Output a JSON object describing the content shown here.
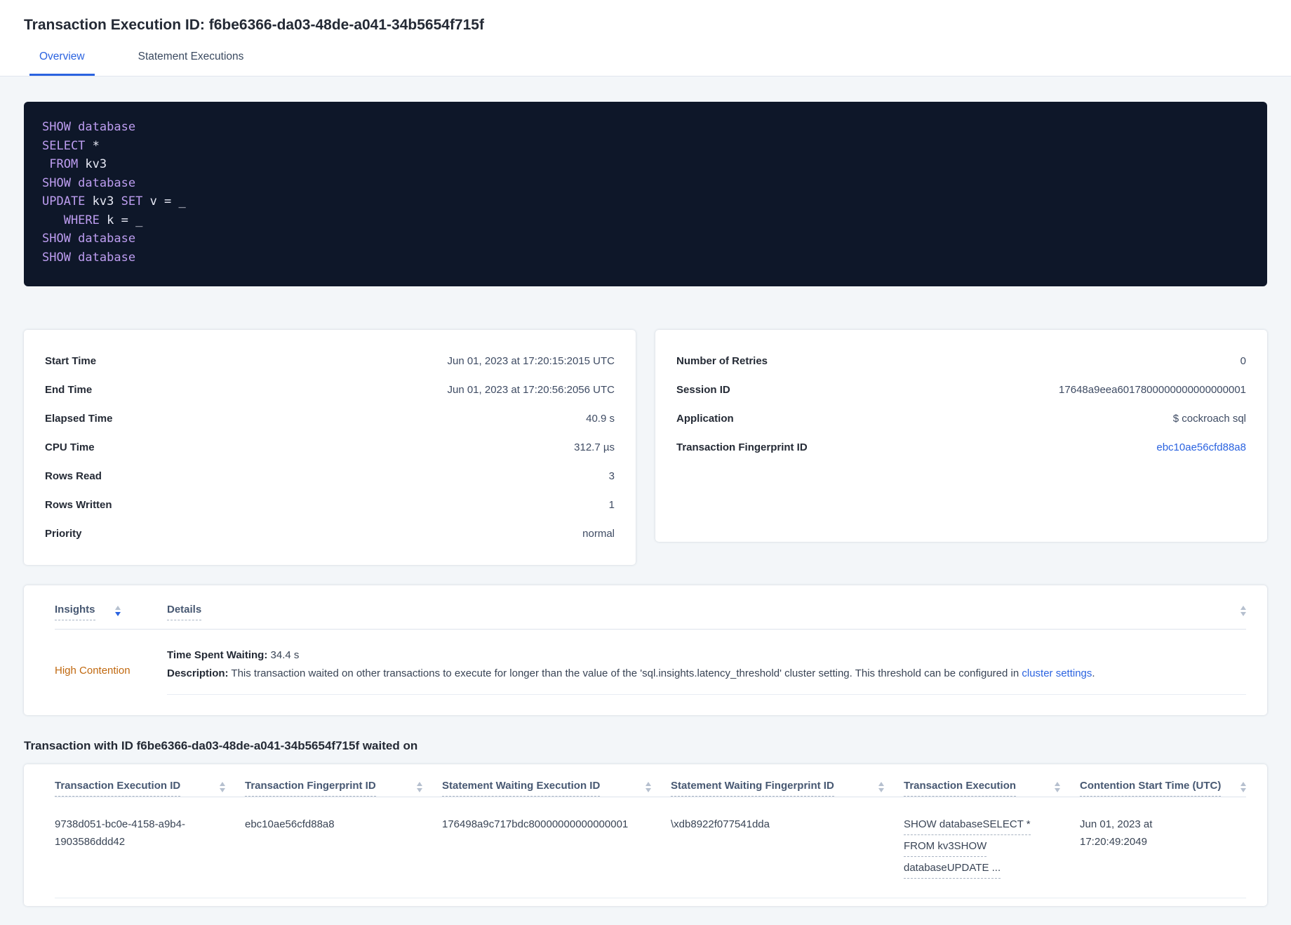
{
  "page": {
    "title": "Transaction Execution ID: f6be6366-da03-48de-a041-34b5654f715f"
  },
  "tabs": [
    {
      "label": "Overview"
    },
    {
      "label": "Statement Executions"
    }
  ],
  "sql": {
    "lines": [
      {
        "segs": [
          {
            "t": "SHOW database",
            "cls": "tok-kw"
          }
        ]
      },
      {
        "segs": [
          {
            "t": "SELECT ",
            "cls": "tok-kw"
          },
          {
            "t": "*",
            "cls": "tok-id"
          }
        ]
      },
      {
        "segs": [
          {
            "t": " FROM ",
            "cls": "tok-kw"
          },
          {
            "t": "kv3",
            "cls": "tok-id"
          }
        ]
      },
      {
        "segs": [
          {
            "t": "SHOW database",
            "cls": "tok-kw"
          }
        ]
      },
      {
        "segs": [
          {
            "t": "UPDATE ",
            "cls": "tok-kw"
          },
          {
            "t": "kv3 ",
            "cls": "tok-id"
          },
          {
            "t": "SET ",
            "cls": "tok-kw"
          },
          {
            "t": "v = _",
            "cls": "tok-id"
          }
        ]
      },
      {
        "segs": [
          {
            "t": "   WHERE ",
            "cls": "tok-kw"
          },
          {
            "t": "k = _",
            "cls": "tok-id"
          }
        ]
      },
      {
        "segs": [
          {
            "t": "SHOW database",
            "cls": "tok-kw"
          }
        ]
      },
      {
        "segs": [
          {
            "t": "SHOW database",
            "cls": "tok-kw"
          }
        ]
      }
    ]
  },
  "summary_left": {
    "rows": [
      {
        "label": "Start Time",
        "value": "Jun 01, 2023 at 17:20:15:2015 UTC"
      },
      {
        "label": "End Time",
        "value": "Jun 01, 2023 at 17:20:56:2056 UTC"
      },
      {
        "label": "Elapsed Time",
        "value": "40.9 s"
      },
      {
        "label": "CPU Time",
        "value": "312.7 µs"
      },
      {
        "label": "Rows Read",
        "value": "3"
      },
      {
        "label": "Rows Written",
        "value": "1"
      },
      {
        "label": "Priority",
        "value": "normal"
      }
    ]
  },
  "summary_right": {
    "rows": [
      {
        "label": "Number of Retries",
        "value": "0"
      },
      {
        "label": "Session ID",
        "value": "17648a9eea6017800000000000000001"
      },
      {
        "label": "Application",
        "value": "$ cockroach sql"
      },
      {
        "label": "Transaction Fingerprint ID",
        "value": "ebc10ae56cfd88a8"
      }
    ]
  },
  "insights": {
    "headers": {
      "insights": "Insights",
      "details": "Details"
    },
    "row": {
      "insight": "High Contention",
      "waiting_label": "Time Spent Waiting:",
      "waiting_value": " 34.4 s",
      "description_label": "Description:",
      "description_text": " This transaction waited on other transactions to execute for longer than the value of the 'sql.insights.latency_threshold' cluster setting. This threshold can be configured in ",
      "link_text": "cluster settings",
      "period": "."
    }
  },
  "waited_on": {
    "heading": "Transaction with ID f6be6366-da03-48de-a041-34b5654f715f waited on",
    "columns": [
      {
        "label": "Transaction Execution ID"
      },
      {
        "label": "Transaction Fingerprint ID"
      },
      {
        "label": "Statement Waiting Execution ID"
      },
      {
        "label": "Statement Waiting Fingerprint ID"
      },
      {
        "label": "Transaction Execution"
      },
      {
        "label": "Contention Start Time (UTC)"
      }
    ],
    "row": {
      "transaction_execution_id": "9738d051-bc0e-4158-a9b4-1903586ddd42",
      "transaction_fingerprint_id": "ebc10ae56cfd88a8",
      "statement_waiting_execution_id": "176498a9c717bdc80000000000000001",
      "statement_waiting_fingerprint_id": "\\xdb8922f077541dda",
      "transaction_execution_lines": [
        "SHOW databaseSELECT *",
        "FROM kv3SHOW",
        "databaseUPDATE ..."
      ],
      "contention_start_time": "Jun 01, 2023 at 17:20:49:2049"
    }
  },
  "colors": {
    "accent_blue": "#2b63e0",
    "insight_orange": "#c0680f",
    "sql_keyword": "#bd9df0",
    "sql_background": "#0e1729"
  }
}
